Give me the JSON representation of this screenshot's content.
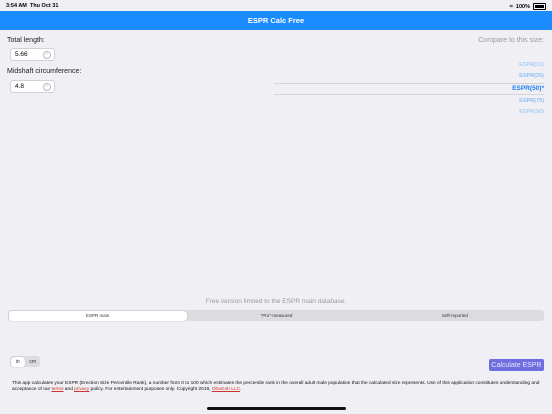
{
  "status_bar": {
    "time": "3:54 AM",
    "date": "Thu Oct 31",
    "battery": "100%"
  },
  "nav": {
    "title": "ESPR Calc Free"
  },
  "inputs": {
    "total_length_label": "Total length:",
    "total_length_value": "5.66",
    "midshaft_label": "Midshaft circumference:",
    "midshaft_value": "4.8"
  },
  "compare": {
    "title": "Compare to this size:",
    "items": [
      "ESPR(10)",
      "ESPR(25)",
      "ESPR(50)*",
      "ESPR(75)",
      "ESPR(90)"
    ],
    "selected_index": 2
  },
  "database": {
    "note": "Free version limited to the ESPR main database.",
    "segments": [
      "ESPR main",
      "\"Pro\"-measured",
      "Self-reported"
    ],
    "active_index": 0
  },
  "units": {
    "options": [
      "in",
      "cm"
    ],
    "active_index": 0
  },
  "calculate_button": "Calculate ESPR",
  "footer": {
    "text1": "This app calculates your ESPR (Erection Size Percentile Rank), a number from 0 to 100 which estimates the percentile rank in the overall adult male population that the calculated size represents.  Use of this application constitutes understanding and acceptance of our ",
    "terms": "terms",
    "and": " and ",
    "privacy": "privacy",
    "text2": " policy.  For entertainment purposes only.  Copyright 2019, ",
    "company": "OhaGoh LLC",
    "end": "."
  },
  "colors": {
    "nav_bar": "#1a8cff",
    "button": "#6f6de0",
    "link": "#d0312d",
    "picker": "#4a9cf5"
  }
}
